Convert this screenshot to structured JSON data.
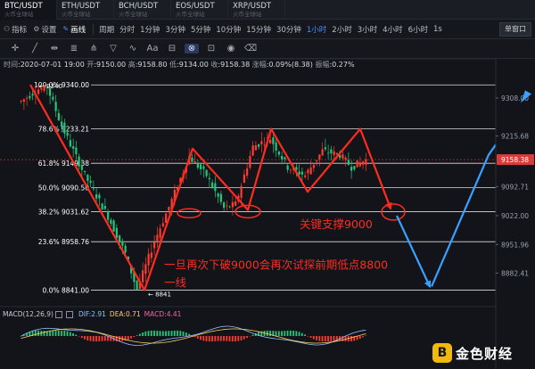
{
  "tabs": [
    {
      "pair": "BTC/USDT",
      "sub": "火币全球站"
    },
    {
      "pair": "ETH/USDT",
      "sub": "火币全球站"
    },
    {
      "pair": "BCH/USDT",
      "sub": "火币全球站"
    },
    {
      "pair": "EOS/USDT",
      "sub": "火币全球站"
    },
    {
      "pair": "XRP/USDT",
      "sub": "火币全球站"
    }
  ],
  "toolbar": {
    "indicator": "指标",
    "settings": "设置",
    "drawing": "画线",
    "period": "周期",
    "periods": [
      "分时",
      "1分钟",
      "3分钟",
      "5分钟",
      "10分钟",
      "15分钟",
      "30分钟",
      "1小时",
      "2小时",
      "3小时",
      "4小时",
      "6小时"
    ],
    "active_period": "1小时",
    "extra": "1s",
    "window": "单窗口"
  },
  "ohlc": {
    "time_label": "时间",
    "time": "2020-07-01 19:00",
    "open_label": "开",
    "open": "9150.00",
    "high_label": "高",
    "high": "9158.80",
    "low_label": "低",
    "low": "9134.00",
    "close_label": "收",
    "close": "9158.38",
    "change_label": "涨幅",
    "change": "0.09%(8.38)",
    "amp_label": "振幅",
    "amp": "0.27%"
  },
  "chart_data": {
    "type": "candlestick",
    "fib_levels": [
      {
        "label": "100.0% 9340.00",
        "pct": 100.0,
        "price": 9340.0
      },
      {
        "label": "78.6% 9233.21",
        "pct": 78.6,
        "price": 9233.21
      },
      {
        "label": "61.8% 9149.38",
        "pct": 61.8,
        "price": 9149.38
      },
      {
        "label": "50.0% 9090.50",
        "pct": 50.0,
        "price": 9090.5
      },
      {
        "label": "38.2% 9031.62",
        "pct": 38.2,
        "price": 9031.62
      },
      {
        "label": "23.6% 8958.76",
        "pct": 23.6,
        "price": 8958.76
      },
      {
        "label": "0.0% 8841.00",
        "pct": 0.0,
        "price": 8841.0
      }
    ],
    "y_ticks": [
      "9308.00",
      "9215.68",
      "9092.71",
      "9022.00",
      "8951.96",
      "8882.41"
    ],
    "y_tick_values": [
      9308.0,
      9215.68,
      9092.71,
      9022.0,
      8951.96,
      8882.41
    ],
    "ylim": [
      8827,
      9360
    ],
    "current_price": "9158.38",
    "current_price_value": 9158.38,
    "high_marker": "9340",
    "low_marker": "8841",
    "candle_stats": {
      "candles": 120,
      "range_low": 8841,
      "range_high": 9340
    },
    "annotations": {
      "support": "关键支撑9000",
      "forecast": "一旦再次下破9000会再次试探前期低点8800一线"
    },
    "colors": {
      "up": "#ff3b30",
      "down": "#21c87a",
      "bg": "#12141a",
      "fib": "#ffffff",
      "arrow_red": "#ff2b1f",
      "arrow_blue": "#3aa0ff",
      "price_tag": "#d63c3c"
    }
  },
  "macd": {
    "name": "MACD(12,26,9)",
    "dif_label": "DIF:",
    "dif": "2.91",
    "dea_label": "DEA:",
    "dea": "0.71",
    "macd_label": "MACD:",
    "macd": "4.41"
  },
  "watermark": {
    "mark": "B",
    "text": "金色财经"
  }
}
